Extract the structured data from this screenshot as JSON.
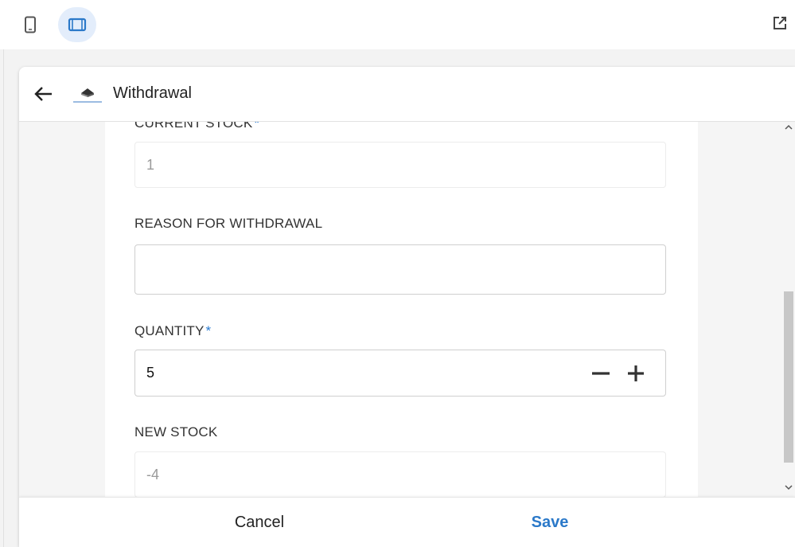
{
  "toolbar": {
    "icons": [
      "phone-icon",
      "tablet-icon",
      "open-external-icon"
    ],
    "active_mode": "tablet"
  },
  "header": {
    "title": "Withdrawal",
    "back_icon": "arrow-left-icon"
  },
  "form": {
    "current_stock": {
      "label": "CURRENT STOCK",
      "required_mark": "*",
      "value": "1"
    },
    "reason": {
      "label": "REASON FOR WITHDRAWAL",
      "value": ""
    },
    "quantity": {
      "label": "QUANTITY",
      "required_mark": "*",
      "value": "5",
      "decrement": "−",
      "increment": "+"
    },
    "new_stock": {
      "label": "NEW STOCK",
      "value": "-4"
    }
  },
  "footer": {
    "cancel_label": "Cancel",
    "save_label": "Save"
  },
  "colors": {
    "accent": "#2b79c9",
    "active_mode_bg": "#e3edfb",
    "required": "#2a7bd1"
  }
}
